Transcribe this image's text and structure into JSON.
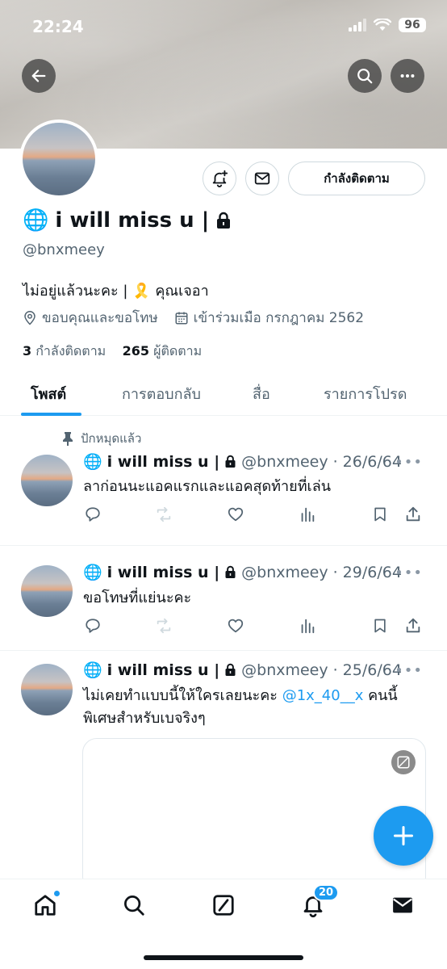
{
  "status_bar": {
    "time": "22:24",
    "battery": "96"
  },
  "profile": {
    "display_name": "i will miss u |",
    "handle": "@bnxmeey",
    "bio": "ไม่อยู่แล้วนะคะ | 🎗️ คุณเจอา",
    "location": "ขอบคุณและขอโทษ",
    "joined": "เข้าร่วมเมือ กรกฎาคม 2562",
    "following_count": "3",
    "following_label": "กำลังติดตาม",
    "followers_count": "265",
    "followers_label": "ผู้ติดตาม",
    "follow_button_label": "กำลังติดตาม"
  },
  "tabs": [
    {
      "label": "โพสต์",
      "active": true
    },
    {
      "label": "การตอบกลับ",
      "active": false
    },
    {
      "label": "สื่อ",
      "active": false
    },
    {
      "label": "รายการโปรด",
      "active": false
    }
  ],
  "pinned_label": "ปักหมุดแล้ว",
  "posts": [
    {
      "name": "i will miss u |",
      "handle": "@bnxmeey",
      "date": "26/6/64",
      "text": "ลาก่อนนะแอคแรกและแอคสุดท้ายที่เล่น"
    },
    {
      "name": "i will miss u |",
      "handle": "@bnxmeey",
      "date": "29/6/64",
      "text": "ขอโทษที่แย่นะคะ"
    },
    {
      "name": "i will miss u |",
      "handle": "@bnxmeey",
      "date": "25/6/64",
      "text_before": "ไม่เคยทำแบบนี้ให้ใครเลยนะคะ ",
      "mention": "@1x_40__x",
      "text_after": " คนนี้พิเศษสำหรับเบจริงๆ"
    }
  ],
  "bottom_nav": {
    "notifications_count": "20"
  },
  "colors": {
    "accent": "#1d9bf0",
    "text": "#0f1419",
    "secondary": "#536471"
  }
}
